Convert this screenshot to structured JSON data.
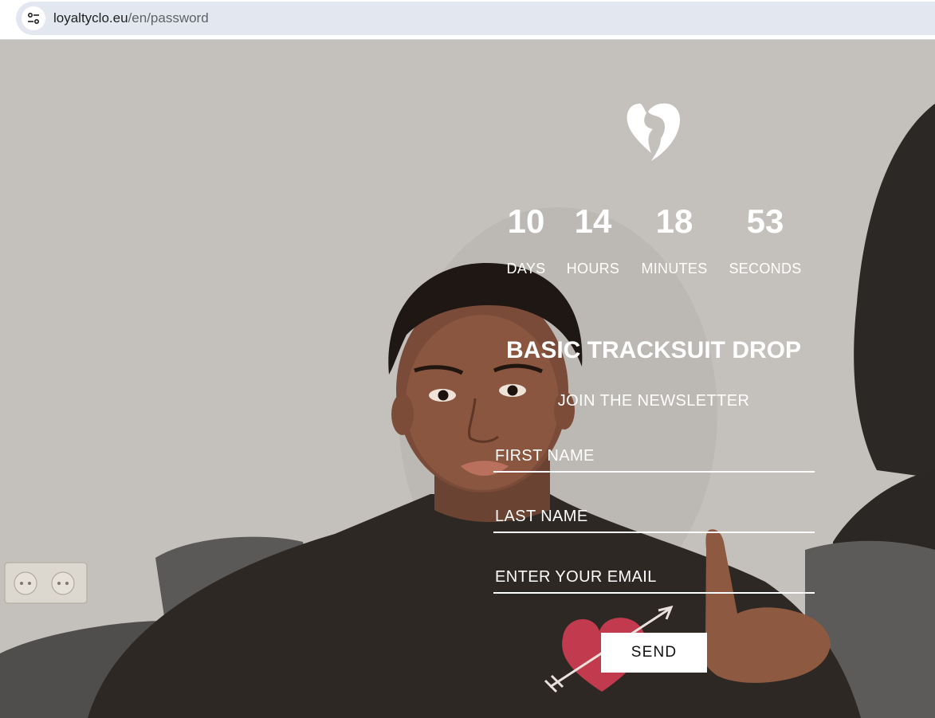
{
  "browser": {
    "url_domain": "loyaltyclo.eu",
    "url_path": "/en/password",
    "site_info_icon": "tune-icon"
  },
  "logo": {
    "icon": "broken-heart-logo-icon"
  },
  "countdown": {
    "days_value": "10",
    "days_label": "DAYS",
    "hours_value": "14",
    "hours_label": "HOURS",
    "minutes_value": "18",
    "minutes_label": "MINUTES",
    "seconds_value": "53",
    "seconds_label": "SECONDS"
  },
  "drop_title": "BASIC TRACKSUIT DROP",
  "newsletter": {
    "heading": "JOIN THE NEWSLETTER",
    "first_name_placeholder": "FIRST NAME",
    "last_name_placeholder": "LAST NAME",
    "email_placeholder": "ENTER YOUR EMAIL",
    "send_label": "SEND"
  }
}
